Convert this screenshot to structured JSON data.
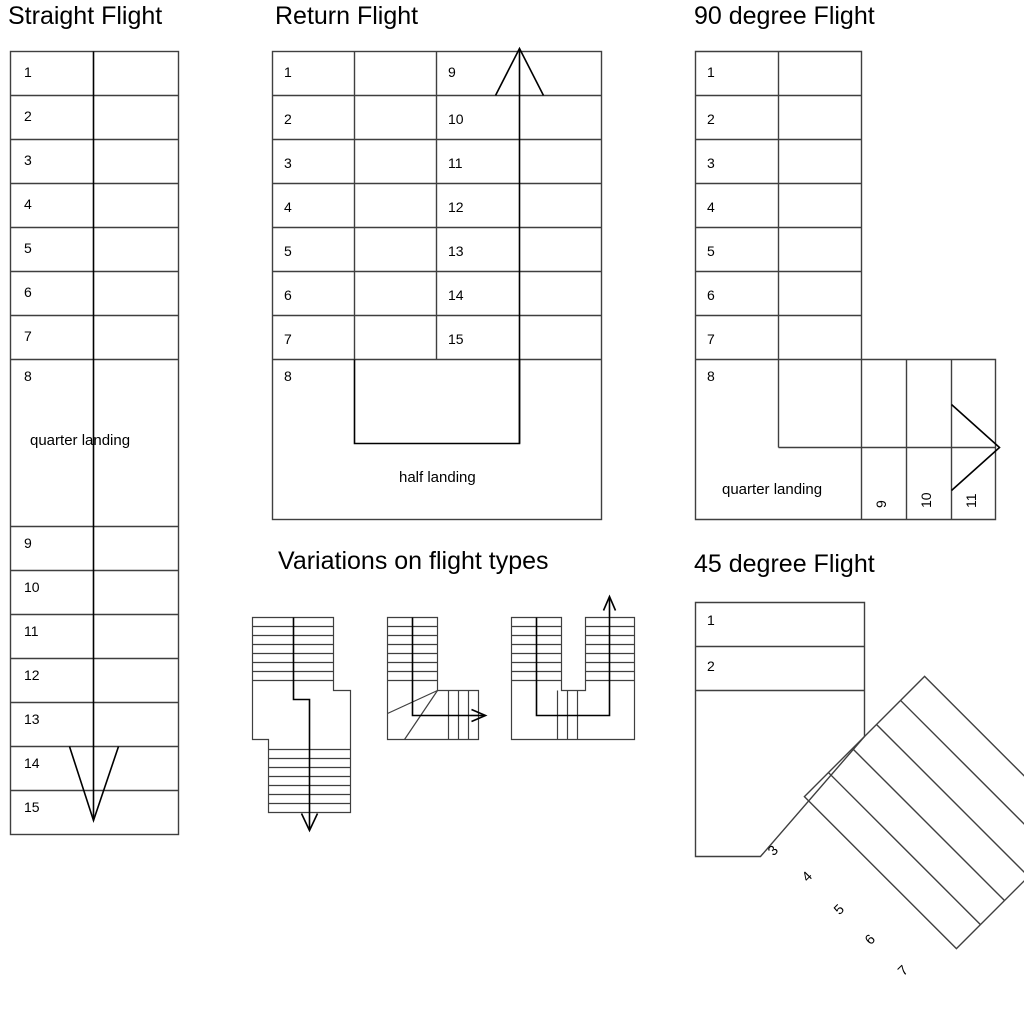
{
  "page": {
    "background": "#ffffff",
    "line_color": "#3f3f3f",
    "line_color_dark": "#000000",
    "text_color": "#000000"
  },
  "sections": {
    "straight_flight": {
      "title": "Straight Flight",
      "steps_upper": [
        "1",
        "2",
        "3",
        "4",
        "5",
        "6",
        "7",
        "8"
      ],
      "landing_label": "quarter landing",
      "steps_lower": [
        "9",
        "10",
        "11",
        "12",
        "13",
        "14",
        "15"
      ],
      "arrow_direction": "down"
    },
    "return_flight": {
      "title": "Return Flight",
      "steps_left": [
        "1",
        "2",
        "3",
        "4",
        "5",
        "6",
        "7",
        "8"
      ],
      "steps_right": [
        "9",
        "10",
        "11",
        "12",
        "13",
        "14",
        "15"
      ],
      "landing_label": "half landing",
      "arrow_direction": "up"
    },
    "ninety_degree_flight": {
      "title": "90 degree Flight",
      "steps_vertical": [
        "1",
        "2",
        "3",
        "4",
        "5",
        "6",
        "7",
        "8"
      ],
      "steps_horizontal": [
        "9",
        "10",
        "11"
      ],
      "landing_label": "quarter landing",
      "arrow_direction": "right"
    },
    "forty_five_degree_flight": {
      "title": "45 degree Flight",
      "steps_vertical": [
        "1",
        "2"
      ],
      "steps_diagonal": [
        "3",
        "4",
        "5",
        "6",
        "7"
      ],
      "rotation_degrees": 45
    },
    "variations": {
      "title": "Variations on flight types",
      "items": [
        {
          "name": "dog-leg-flight",
          "arrow_direction": "down",
          "upper_treads": 8,
          "lower_treads": 9
        },
        {
          "name": "l-shaped-winder-flight",
          "arrow_direction": "right",
          "upper_treads": 8,
          "lower_treads": 4,
          "winders": 3
        },
        {
          "name": "u-shaped-flight",
          "arrow_direction": "up",
          "left_treads": 7,
          "right_treads": 7,
          "bottom_treads": 3
        }
      ]
    }
  }
}
